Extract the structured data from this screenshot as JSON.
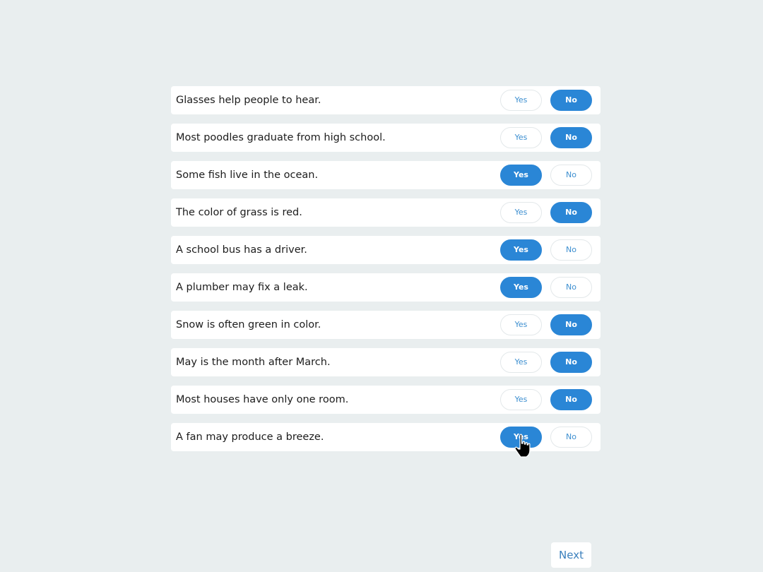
{
  "questions": [
    {
      "text": "Glasses help people to hear.",
      "selected": "no"
    },
    {
      "text": "Most poodles graduate from high school.",
      "selected": "no"
    },
    {
      "text": "Some fish live in the ocean.",
      "selected": "yes"
    },
    {
      "text": "The color of grass is red.",
      "selected": "no"
    },
    {
      "text": "A school bus has a driver.",
      "selected": "yes"
    },
    {
      "text": "A plumber may fix a leak.",
      "selected": "yes"
    },
    {
      "text": "Snow is often green in color.",
      "selected": "no"
    },
    {
      "text": "May is the month after March.",
      "selected": "no"
    },
    {
      "text": "Most houses have only one room.",
      "selected": "no"
    },
    {
      "text": "A fan may produce a breeze.",
      "selected": "yes"
    }
  ],
  "answers": {
    "yes_label": "Yes",
    "no_label": "No"
  },
  "footer": {
    "next_label": "Next"
  },
  "icons": {
    "cursor": "hand-pointer-icon"
  },
  "colors": {
    "background": "#e9eeef",
    "accent": "#2a86d6",
    "accent_text": "#3d8fd0",
    "row_background": "#ffffff"
  }
}
